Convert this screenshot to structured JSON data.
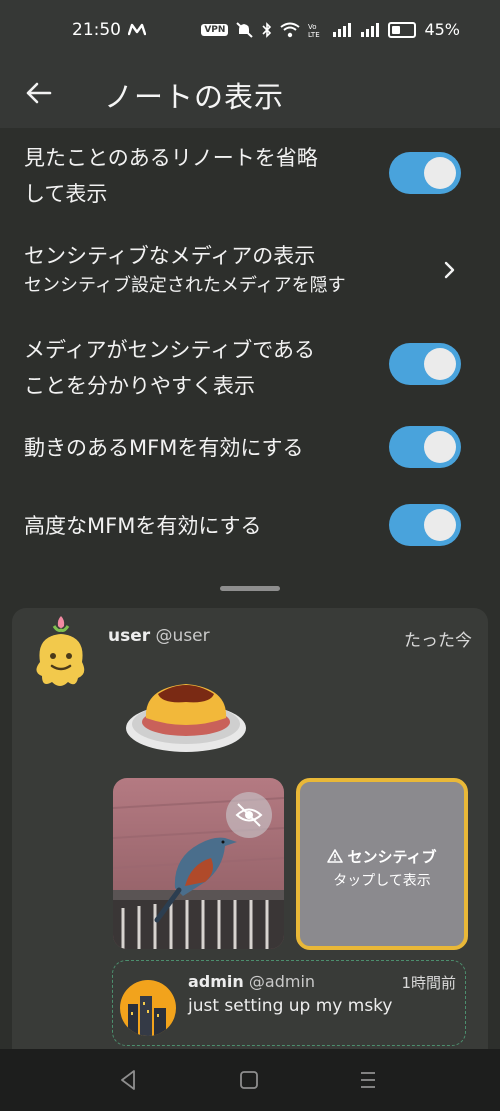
{
  "status_bar": {
    "time": "21:50",
    "vpn_label": "VPN",
    "battery_percent": "45%",
    "battery_level": 0.45,
    "icons": [
      "misskey-icon",
      "vpn-icon",
      "mute-icon",
      "bluetooth-icon",
      "wifi-icon",
      "volte-icon",
      "signal-icon",
      "signal-icon",
      "battery-icon"
    ]
  },
  "app_bar": {
    "title": "ノートの表示",
    "back_icon": "arrow-left-icon"
  },
  "settings": {
    "collapse_renotes": {
      "line1": "見たことのあるリノートを省略",
      "line2": "して表示",
      "enabled": true
    },
    "sensitive_media": {
      "title": "センシティブなメディアの表示",
      "subtitle": "センシティブ設定されたメディアを隠す",
      "icon": "chevron-right-icon"
    },
    "highlight_sensitive": {
      "line1": "メディアがセンシティブである",
      "line2": "ことを分かりやすく表示",
      "enabled": true
    },
    "animated_mfm": {
      "label": "動きのあるMFMを有効にする",
      "enabled": true
    },
    "advanced_mfm": {
      "label": "高度なMFMを有効にする",
      "enabled": true
    }
  },
  "preview": {
    "user_name": "user",
    "user_handle": "@user",
    "time": "たった今",
    "emoji": "pudding-emoji",
    "media_hide_icon": "eye-slash-icon",
    "sensitive_label": "センシティブ",
    "sensitive_tap": "タップして表示",
    "warning_icon": "warning-icon",
    "quote": {
      "user_name": "admin",
      "user_handle": "@admin",
      "time": "1時間前",
      "text": "just setting up my msky"
    }
  },
  "colors": {
    "background": "#2d2f2c",
    "toggle_on": "#49a3dc",
    "sensitive_border": "#e9b838",
    "quote_border": "#4c8f6e"
  }
}
